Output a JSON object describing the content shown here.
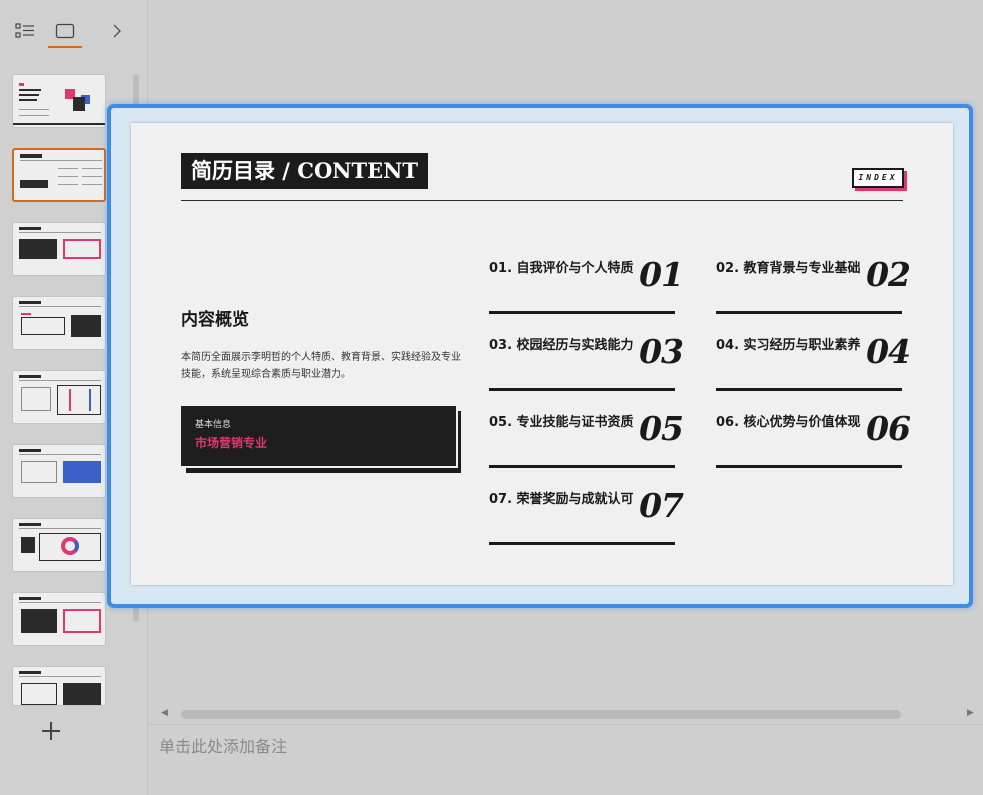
{
  "left_panel": {
    "tabs": [
      {
        "name": "outline",
        "icon": "outline-list-icon"
      },
      {
        "name": "slides",
        "icon": "slide-view-icon"
      },
      {
        "name": "next",
        "icon": "chevron-right-icon"
      }
    ],
    "accent": "#d06a1e",
    "thumbnails": [
      1,
      2,
      3,
      4,
      5,
      6,
      7,
      8,
      9
    ],
    "active_thumbnail": 2,
    "add_icon": "plus-icon"
  },
  "slide": {
    "title": "简历目录 / CONTENT",
    "index_tag": "INDEX",
    "overview_heading": "内容概览",
    "overview_desc": "本简历全面展示李明哲的个人特质、教育背景、实践经验及专业技能，系统呈现综合素质与职业潜力。",
    "info_card": {
      "label": "基本信息",
      "value": "市场营销专业"
    },
    "toc": [
      {
        "text": "01. 自我评价与个人特质",
        "num": "01"
      },
      {
        "text": "02. 教育背景与专业基础",
        "num": "02"
      },
      {
        "text": "03. 校园经历与实践能力",
        "num": "03"
      },
      {
        "text": "04. 实习经历与职业素养",
        "num": "04"
      },
      {
        "text": "05. 专业技能与证书资质",
        "num": "05"
      },
      {
        "text": "06. 核心优势与价值体现",
        "num": "06"
      },
      {
        "text": "07. 荣誉奖励与成就认可",
        "num": "07"
      }
    ],
    "colors": {
      "pink": "#e2376e",
      "dark": "#1c1c1c",
      "selection": "#3c8ce8"
    }
  },
  "notes_placeholder": "单击此处添加备注"
}
